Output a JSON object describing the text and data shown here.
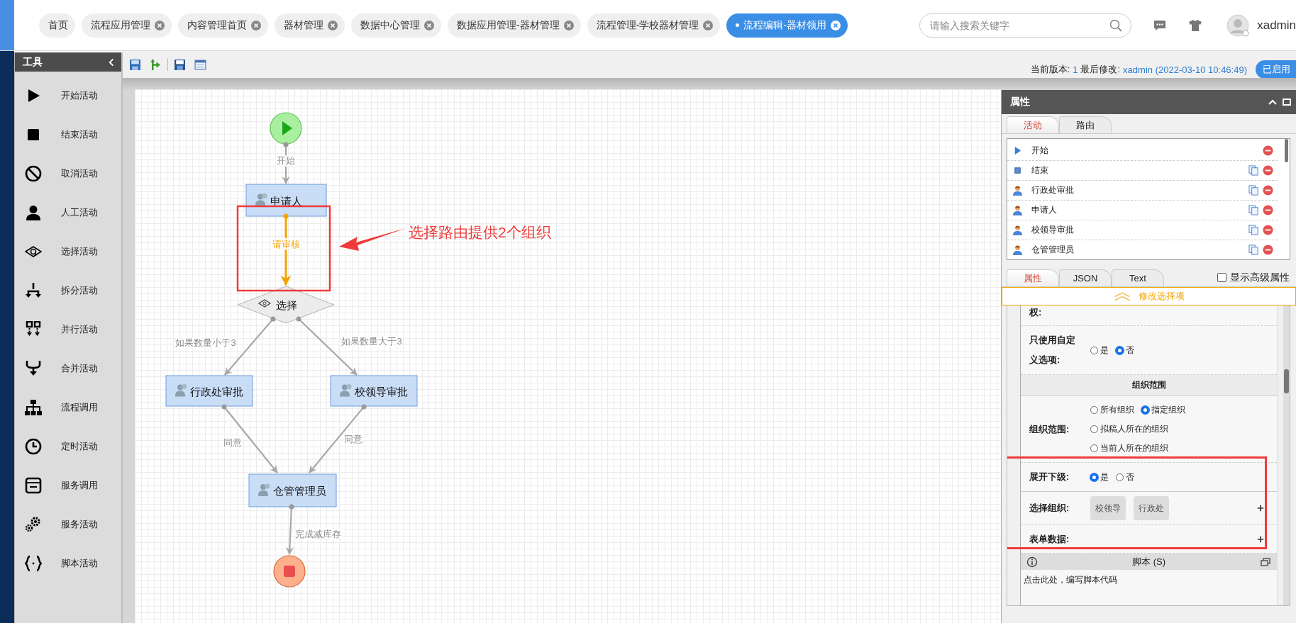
{
  "top_tabs": [
    {
      "label": "首页",
      "closable": false,
      "selected": false
    },
    {
      "label": "流程应用管理",
      "closable": true,
      "selected": false
    },
    {
      "label": "内容管理首页",
      "closable": true,
      "selected": false
    },
    {
      "label": "器材管理",
      "closable": true,
      "selected": false
    },
    {
      "label": "数据中心管理",
      "closable": true,
      "selected": false
    },
    {
      "label": "数据应用管理-器材管理",
      "closable": true,
      "selected": false
    },
    {
      "label": "流程管理-学校器材管理",
      "closable": true,
      "selected": false
    },
    {
      "label": "流程编辑-器材领用",
      "closable": true,
      "selected": true
    }
  ],
  "search": {
    "placeholder": "请输入搜索关键字"
  },
  "user": {
    "name": "xadmin"
  },
  "tool_panel": {
    "title": "工具",
    "items": [
      {
        "kind": "start",
        "label": "开始活动"
      },
      {
        "kind": "end",
        "label": "结束活动"
      },
      {
        "kind": "cancel",
        "label": "取消活动"
      },
      {
        "kind": "manual",
        "label": "人工活动"
      },
      {
        "kind": "choice",
        "label": "选择活动"
      },
      {
        "kind": "split",
        "label": "拆分活动"
      },
      {
        "kind": "parallel",
        "label": "并行活动"
      },
      {
        "kind": "merge",
        "label": "合并活动"
      },
      {
        "kind": "subprocess",
        "label": "流程调用"
      },
      {
        "kind": "timer",
        "label": "定时活动"
      },
      {
        "kind": "servicecall",
        "label": "服务调用"
      },
      {
        "kind": "service",
        "label": "服务活动"
      },
      {
        "kind": "script",
        "label": "脚本活动"
      }
    ]
  },
  "version_info": {
    "version_label": "当前版本:",
    "version": "1",
    "modified_label": "最后修改:",
    "modified_by": "xadmin (2022-03-10 10:46:49)",
    "status": "已启用"
  },
  "diagram": {
    "nodes": [
      {
        "kind": "start"
      },
      {
        "kind": "task",
        "label": "申请人"
      },
      {
        "kind": "choice",
        "label": "选择"
      },
      {
        "kind": "task",
        "label": "行政处审批"
      },
      {
        "kind": "task",
        "label": "校领导审批"
      },
      {
        "kind": "task",
        "label": "仓管管理员"
      },
      {
        "kind": "end"
      }
    ],
    "edges": [
      {
        "label": "开始",
        "selected": false
      },
      {
        "label": "请审核",
        "selected": true
      },
      {
        "label": "如果数量小于3",
        "selected": false
      },
      {
        "label": "如果数量大于3",
        "selected": false
      },
      {
        "label": "同意",
        "selected": false
      },
      {
        "label": "同意",
        "selected": false
      },
      {
        "label": "完成减库存",
        "selected": false
      }
    ],
    "annotation": {
      "text": "选择路由提供2个组织"
    }
  },
  "properties_panel": {
    "title": "属性",
    "tabs": [
      {
        "label": "活动",
        "selected": true
      },
      {
        "label": "路由",
        "selected": false
      }
    ],
    "activities": [
      {
        "kind": "start",
        "label": "开始",
        "copyable": false
      },
      {
        "kind": "end",
        "label": "结束",
        "copyable": true
      },
      {
        "kind": "user",
        "label": "行政处审批",
        "copyable": true
      },
      {
        "kind": "user",
        "label": "申请人",
        "copyable": true
      },
      {
        "kind": "user",
        "label": "校领导审批",
        "copyable": true
      },
      {
        "kind": "user",
        "label": "仓管管理员",
        "copyable": true
      }
    ],
    "detail_tabs": [
      {
        "label": "属性",
        "selected": true
      },
      {
        "label": "JSON",
        "selected": false
      },
      {
        "label": "Text",
        "selected": false
      }
    ],
    "advanced": {
      "label": "显示高级属性",
      "checked": false
    },
    "banner": "修改选择项",
    "form": [
      {
        "kind": "label",
        "label": "权:"
      },
      {
        "kind": "radio",
        "label": "只使用自定义选项:",
        "options": [
          {
            "label": "是",
            "selected": false
          },
          {
            "label": "否",
            "selected": true
          }
        ]
      },
      {
        "kind": "section",
        "label": "组织范围"
      },
      {
        "kind": "radio",
        "label": "组织范围:",
        "options": [
          {
            "label": "所有组织",
            "selected": false
          },
          {
            "label": "指定组织",
            "selected": true
          },
          {
            "label": "拟稿人所在的组织",
            "selected": false
          },
          {
            "label": "当前人所在的组织",
            "selected": false
          }
        ]
      },
      {
        "kind": "radio",
        "label": "展开下级:",
        "options": [
          {
            "label": "是",
            "selected": true
          },
          {
            "label": "否",
            "selected": false
          }
        ]
      },
      {
        "kind": "chips",
        "label": "选择组织:",
        "chips": [
          "校领导",
          "行政处"
        ]
      },
      {
        "kind": "add",
        "label": "表单数据:"
      }
    ],
    "script": {
      "title": "脚本 (S)",
      "hint": "点击此处，编写脚本代码"
    }
  }
}
